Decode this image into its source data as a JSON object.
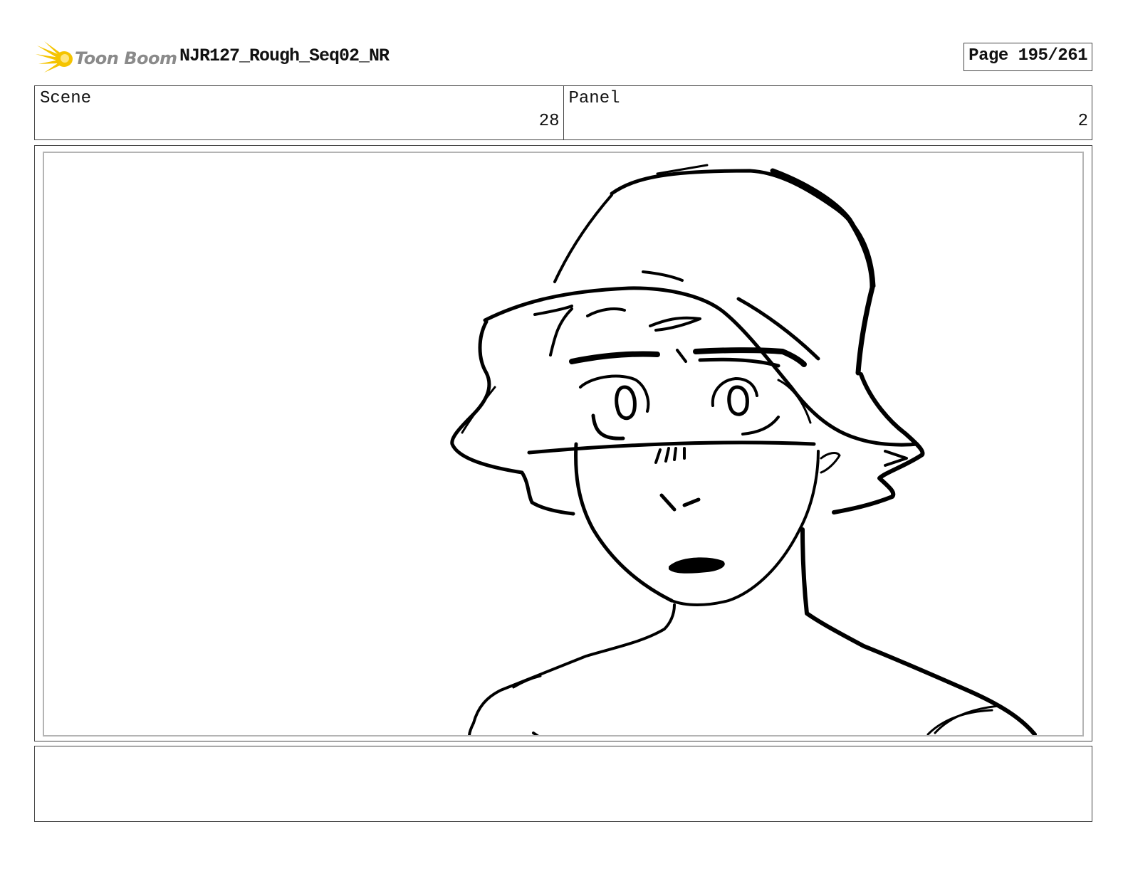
{
  "header": {
    "logo_text": "Toon Boom",
    "logo_icon": "starburst-icon",
    "document_title": "NJR127_Rough_Seq02_NR",
    "page_label": "Page 195/261"
  },
  "info": {
    "scene_label": "Scene",
    "scene_value": "28",
    "panel_label": "Panel",
    "panel_value": "2"
  },
  "notes": {
    "text": ""
  },
  "colors": {
    "logo_accent": "#f5c400",
    "logo_text": "#8a8a8a",
    "frame_border": "#444444",
    "inner_border": "#b4b4b4"
  }
}
